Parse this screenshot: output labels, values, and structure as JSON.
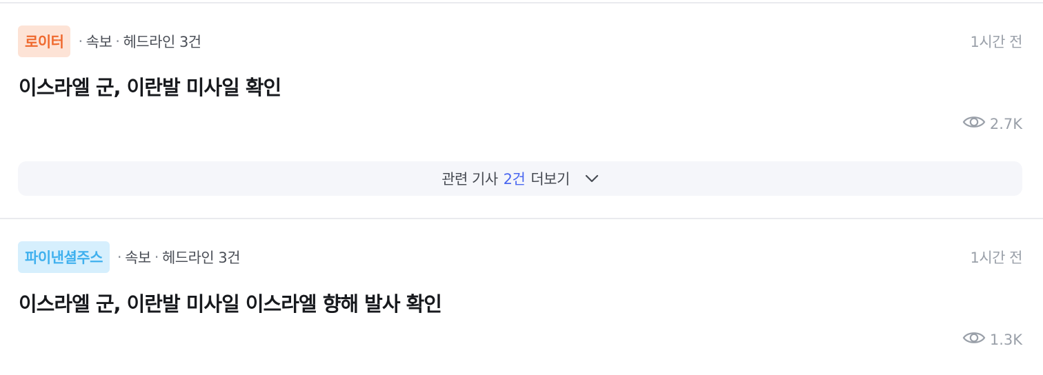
{
  "items": [
    {
      "source": "로이터",
      "source_color": "#ef6a2f",
      "source_bg": "#fde3d6",
      "category": "속보",
      "headline_count": "헤드라인 3건",
      "time": "1시간 전",
      "title": "이스라엘 군, 이란발 미사일 확인",
      "views_icon": "eye-icon",
      "views": "2.7K",
      "related": {
        "prefix": "관련 기사",
        "count": "2건",
        "suffix": "더보기",
        "icon": "chevron-down-icon"
      }
    },
    {
      "source": "파이낸셜주스",
      "source_color": "#3fb0ee",
      "source_bg": "#d6effd",
      "category": "속보",
      "headline_count": "헤드라인 3건",
      "time": "1시간 전",
      "title": "이스라엘 군, 이란발 미사일 이스라엘 향해 발사 확인",
      "views_icon": "eye-icon",
      "views": "1.3K"
    }
  ],
  "colors": {
    "accent_link": "#4a67f0",
    "muted_text": "#9aa0a9",
    "divider": "#e9eaee"
  }
}
